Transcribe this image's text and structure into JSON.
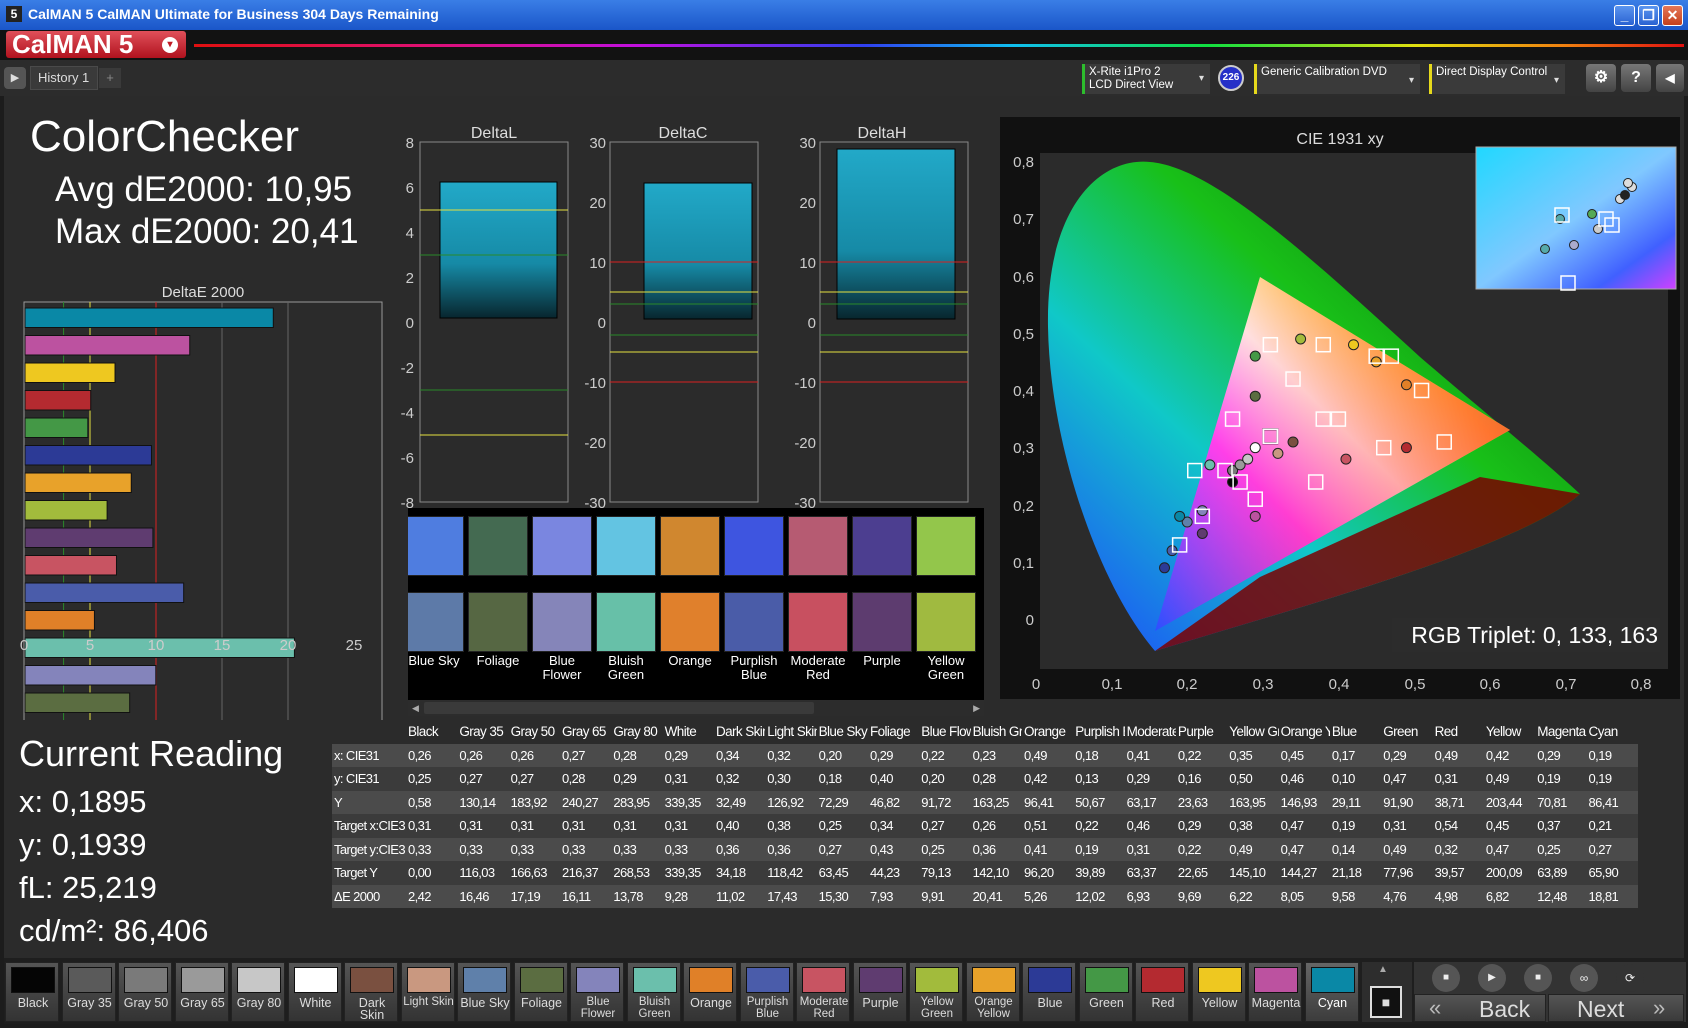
{
  "window": {
    "title": "CalMAN 5 CalMAN Ultimate for Business 304 Days Remaining",
    "min": "_",
    "max": "❐",
    "close": "✕",
    "app_icon": "5"
  },
  "app": {
    "logo": "CalMAN 5",
    "logo_dd": "▾"
  },
  "toolbar": {
    "play": "▶",
    "tab_label": "History 1",
    "tab_add": "+",
    "meter": {
      "line1": "X-Rite i1Pro 2",
      "line2": "LCD Direct View"
    },
    "meter_badge": "226",
    "source": "Generic Calibration DVD",
    "display": "Direct Display Control",
    "dd": "▾",
    "settings_icon": "⚙",
    "help_icon": "?",
    "collapse_icon": "◀"
  },
  "left": {
    "title": "ColorChecker",
    "avg": "Avg dE2000: 10,95",
    "max": "Max dE2000: 20,41"
  },
  "deltae_chart": {
    "title": "DeltaE 2000",
    "ticks": [
      "0",
      "5",
      "10",
      "15",
      "20",
      "25"
    ]
  },
  "dL_chart": {
    "title": "DeltaL",
    "ticks": [
      "8",
      "6",
      "4",
      "2",
      "0",
      "-2",
      "-4",
      "-6",
      "-8"
    ]
  },
  "dC_chart": {
    "title": "DeltaC",
    "ticks": [
      "30",
      "20",
      "10",
      "0",
      "-10",
      "-20",
      "-30"
    ]
  },
  "dH_chart": {
    "title": "DeltaH",
    "ticks": [
      "30",
      "20",
      "10",
      "0",
      "-10",
      "-20",
      "-30"
    ]
  },
  "patches": [
    {
      "label": "Blue Sky",
      "actual": "#4f7de0",
      "target": "#5d7aa8"
    },
    {
      "label": "Foliage",
      "actual": "#446a51",
      "target": "#566743"
    },
    {
      "label": "Blue Flower",
      "actual": "#7a86e0",
      "target": "#8585b9"
    },
    {
      "label": "Bluish Green",
      "actual": "#63c4e2",
      "target": "#67c0a8"
    },
    {
      "label": "Orange",
      "actual": "#d0872f",
      "target": "#e0802c"
    },
    {
      "label": "Purplish Blue",
      "actual": "#3e55e0",
      "target": "#4a5ca8"
    },
    {
      "label": "Moderate Red",
      "actual": "#b65b72",
      "target": "#c85060"
    },
    {
      "label": "Purple",
      "actual": "#4c3e90",
      "target": "#5d3c6f"
    },
    {
      "label": "Yellow Green",
      "actual": "#93c64b",
      "target": "#a0ba40"
    }
  ],
  "cie": {
    "title": "CIE 1931 xy",
    "rgb_triplet": "RGB Triplet: 0, 133, 163",
    "y_ticks": [
      "0,8",
      "0,7",
      "0,6",
      "0,5",
      "0,4",
      "0,3",
      "0,2",
      "0,1",
      "0"
    ],
    "x_ticks": [
      "0",
      "0,1",
      "0,2",
      "0,3",
      "0,4",
      "0,5",
      "0,6",
      "0,7",
      "0,8"
    ]
  },
  "current": {
    "title": "Current Reading",
    "x": "x: 0,1895",
    "y": "y: 0,1939",
    "fl": "fL: 25,219",
    "cdm": "cd/m²: 86,406"
  },
  "table": {
    "columns": [
      "",
      "Black",
      "Gray 35",
      "Gray 50",
      "Gray 65",
      "Gray 80",
      "White",
      "Dark Skin",
      "Light Skin",
      "Blue Sky",
      "Foliage",
      "Blue Flower",
      "Bluish Green",
      "Orange",
      "Purplish Blue",
      "Moderate Red",
      "Purple",
      "Yellow Green",
      "Orange Yellow",
      "Blue",
      "Green",
      "Red",
      "Yellow",
      "Magenta",
      "Cyan"
    ],
    "rows": [
      [
        "x: CIE31",
        "0,26",
        "0,26",
        "0,26",
        "0,27",
        "0,28",
        "0,29",
        "0,34",
        "0,32",
        "0,20",
        "0,29",
        "0,22",
        "0,23",
        "0,49",
        "0,18",
        "0,41",
        "0,22",
        "0,35",
        "0,45",
        "0,17",
        "0,29",
        "0,49",
        "0,42",
        "0,29",
        "0,19"
      ],
      [
        "y: CIE31",
        "0,25",
        "0,27",
        "0,27",
        "0,28",
        "0,29",
        "0,31",
        "0,32",
        "0,30",
        "0,18",
        "0,40",
        "0,20",
        "0,28",
        "0,42",
        "0,13",
        "0,29",
        "0,16",
        "0,50",
        "0,46",
        "0,10",
        "0,47",
        "0,31",
        "0,49",
        "0,19",
        "0,19"
      ],
      [
        "Y",
        "0,58",
        "130,14",
        "183,92",
        "240,27",
        "283,95",
        "339,35",
        "32,49",
        "126,92",
        "72,29",
        "46,82",
        "91,72",
        "163,25",
        "96,41",
        "50,67",
        "63,17",
        "23,63",
        "163,95",
        "146,93",
        "29,11",
        "91,90",
        "38,71",
        "203,44",
        "70,81",
        "86,41"
      ],
      [
        "Target x:CIE31",
        "0,31",
        "0,31",
        "0,31",
        "0,31",
        "0,31",
        "0,31",
        "0,40",
        "0,38",
        "0,25",
        "0,34",
        "0,27",
        "0,26",
        "0,51",
        "0,22",
        "0,46",
        "0,29",
        "0,38",
        "0,47",
        "0,19",
        "0,31",
        "0,54",
        "0,45",
        "0,37",
        "0,21"
      ],
      [
        "Target y:CIE31",
        "0,33",
        "0,33",
        "0,33",
        "0,33",
        "0,33",
        "0,33",
        "0,36",
        "0,36",
        "0,27",
        "0,43",
        "0,25",
        "0,36",
        "0,41",
        "0,19",
        "0,31",
        "0,22",
        "0,49",
        "0,47",
        "0,14",
        "0,49",
        "0,32",
        "0,47",
        "0,25",
        "0,27"
      ],
      [
        "Target Y",
        "0,00",
        "116,03",
        "166,63",
        "216,37",
        "268,53",
        "339,35",
        "34,18",
        "118,42",
        "63,45",
        "44,23",
        "79,13",
        "142,10",
        "96,20",
        "39,89",
        "63,37",
        "22,65",
        "145,10",
        "144,27",
        "21,18",
        "77,96",
        "39,57",
        "200,09",
        "63,89",
        "65,90"
      ],
      [
        "ΔE 2000",
        "2,42",
        "16,46",
        "17,19",
        "16,11",
        "13,78",
        "9,28",
        "11,02",
        "17,43",
        "15,30",
        "7,93",
        "9,91",
        "20,41",
        "5,26",
        "12,02",
        "6,93",
        "9,69",
        "6,22",
        "8,05",
        "9,58",
        "4,76",
        "4,98",
        "6,82",
        "12,48",
        "18,81"
      ]
    ]
  },
  "swatches": [
    {
      "label": "Black",
      "color": "#050505"
    },
    {
      "label": "Gray 35",
      "color": "#5a5a5a"
    },
    {
      "label": "Gray 50",
      "color": "#7a7a7a"
    },
    {
      "label": "Gray 65",
      "color": "#9a9a9a"
    },
    {
      "label": "Gray 80",
      "color": "#c7c7c7"
    },
    {
      "label": "White",
      "color": "#ffffff"
    },
    {
      "label": "Dark Skin",
      "color": "#7a5040"
    },
    {
      "label": "Light Skin",
      "color": "#c99880"
    },
    {
      "label": "Blue Sky",
      "color": "#5f80aa"
    },
    {
      "label": "Foliage",
      "color": "#5b6d41"
    },
    {
      "label": "Blue Flower",
      "color": "#8484bb"
    },
    {
      "label": "Bluish Green",
      "color": "#6bbfac"
    },
    {
      "label": "Orange",
      "color": "#e08028"
    },
    {
      "label": "Purplish Blue",
      "color": "#4a5caa"
    },
    {
      "label": "Moderate Red",
      "color": "#c85462"
    },
    {
      "label": "Purple",
      "color": "#5f3c70"
    },
    {
      "label": "Yellow Green",
      "color": "#a2bb3c"
    },
    {
      "label": "Orange Yellow",
      "color": "#e8a22a"
    },
    {
      "label": "Blue",
      "color": "#2c3a96"
    },
    {
      "label": "Green",
      "color": "#449846"
    },
    {
      "label": "Red",
      "color": "#b42a30"
    },
    {
      "label": "Yellow",
      "color": "#eec820"
    },
    {
      "label": "Magenta",
      "color": "#bc52a0"
    },
    {
      "label": "Cyan",
      "color": "#0a88a6"
    }
  ],
  "nav": {
    "back": "Back",
    "next": "Next",
    "back_icon": "«",
    "next_icon": "»",
    "stop_icon": "■",
    "play_icon": "▶",
    "loop_icon": "∞",
    "refresh_icon": "⟳",
    "up_icon": "▲"
  }
}
